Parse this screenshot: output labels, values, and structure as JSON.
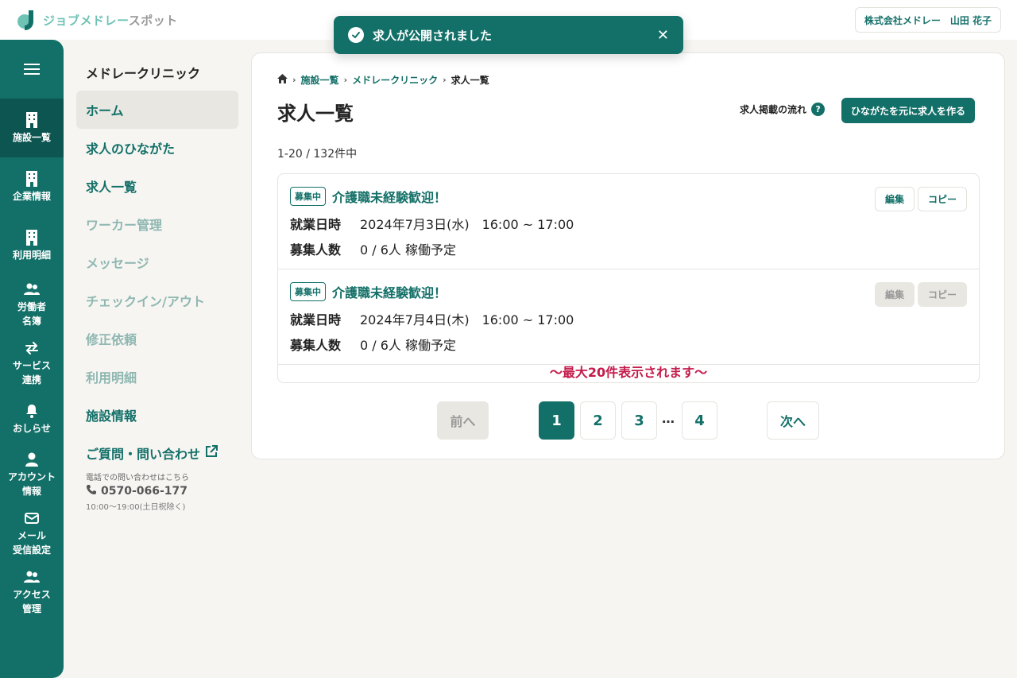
{
  "header": {
    "logo_text": "ジョブメドレー",
    "logo_sub": "スポット",
    "user_label": "株式会社メドレー　山田 花子"
  },
  "toast": {
    "message": "求人が公開されました",
    "close": "✕"
  },
  "rail": {
    "items": [
      {
        "label": "施設一覧",
        "icon": "building-icon"
      },
      {
        "label": "企業情報",
        "icon": "building-icon"
      },
      {
        "label": "利用明細",
        "icon": "building-icon"
      },
      {
        "label": "労働者\n名簿",
        "icon": "people-icon"
      },
      {
        "label": "サービス\n連携",
        "icon": "arrows-swap-icon"
      },
      {
        "label": "おしらせ",
        "icon": "bell-icon"
      },
      {
        "label": "アカウント\n情報",
        "icon": "person-icon"
      },
      {
        "label": "メール\n受信設定",
        "icon": "mail-icon"
      },
      {
        "label": "アクセス\n管理",
        "icon": "people-icon"
      }
    ]
  },
  "sidebar": {
    "facility": "メドレークリニック",
    "items": [
      {
        "label": "ホーム"
      },
      {
        "label": "求人のひながた"
      },
      {
        "label": "求人一覧"
      },
      {
        "label": "ワーカー管理"
      },
      {
        "label": "メッセージ"
      },
      {
        "label": "チェックイン/アウト"
      },
      {
        "label": "修正依頼"
      },
      {
        "label": "利用明細"
      },
      {
        "label": "施設情報"
      }
    ],
    "contact": {
      "link": "ご質問・問い合わせ",
      "note": "電話での問い合わせはこちら",
      "tel": "0570-066-177",
      "hours": "10:00〜19:00(土日祝除く)"
    }
  },
  "main": {
    "breadcrumbs": [
      "施設一覧",
      "メドレークリニック",
      "求人一覧"
    ],
    "title": "求人一覧",
    "flow_label": "求人掲載の流れ",
    "create_button": "ひながたを元に求人を作る",
    "count": "1-20 / 132件中",
    "jobs": [
      {
        "status": "募集中",
        "title": "介護職未経験歓迎！",
        "date_key": "就業日時",
        "date_value": "2024年7月3日(水)　16:00 ~ 17:00",
        "people_key": "募集人数",
        "people_value": "0 / 6人 稼働予定",
        "edit": "編集",
        "copy": "コピー"
      },
      {
        "status": "募集中",
        "title": "介護職未経験歓迎！",
        "date_key": "就業日時",
        "date_value": "2024年7月4日(木)　16:00 ~ 17:00",
        "people_key": "募集人数",
        "people_value": "0 / 6人 稼働予定",
        "edit": "編集",
        "copy": "コピー"
      }
    ],
    "max_note": "〜最大20件表示されます〜",
    "pagination": {
      "prev": "前へ",
      "pages": [
        "1",
        "2",
        "3",
        "4"
      ],
      "ellipsis": "…",
      "next": "次へ",
      "current": "1"
    }
  }
}
